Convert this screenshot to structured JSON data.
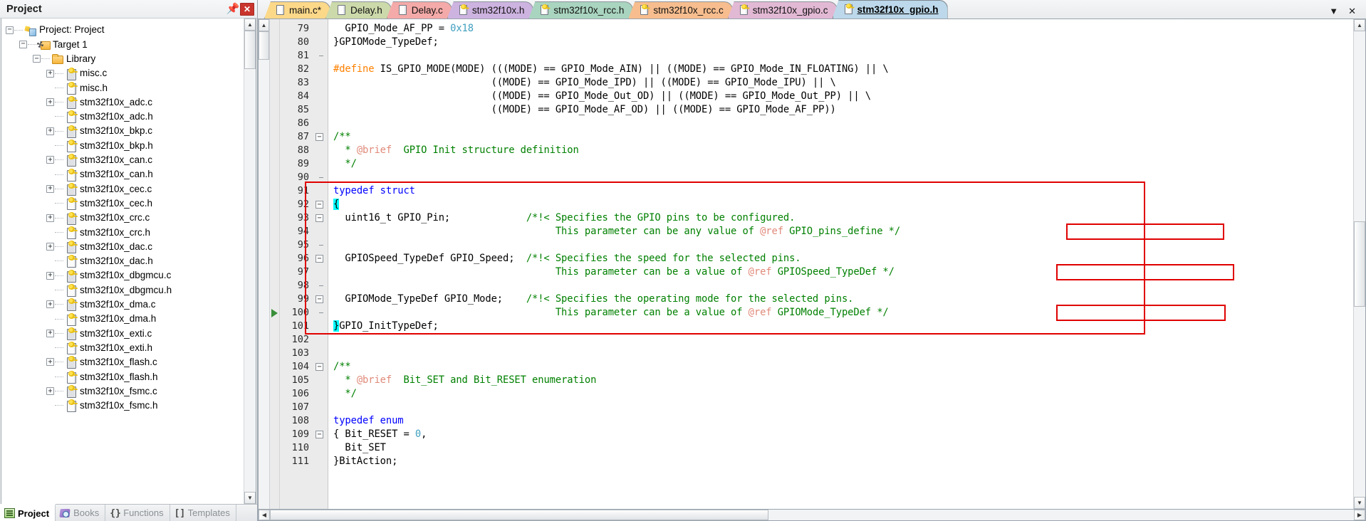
{
  "project_panel": {
    "title": "Project",
    "pin_icon": "pin-icon",
    "close_icon": "close-icon",
    "tree": [
      {
        "label": "Project: Project",
        "depth": 0,
        "twist": "minus",
        "icon": "project-icon"
      },
      {
        "label": "Target 1",
        "depth": 1,
        "twist": "minus",
        "icon": "target-icon"
      },
      {
        "label": "Library",
        "depth": 2,
        "twist": "minus",
        "icon": "folder-icon"
      },
      {
        "label": "misc.c",
        "depth": 3,
        "twist": "plus",
        "icon": "source-file-icon"
      },
      {
        "label": "misc.h",
        "depth": 3,
        "twist": "none",
        "icon": "header-file-icon"
      },
      {
        "label": "stm32f10x_adc.c",
        "depth": 3,
        "twist": "plus",
        "icon": "source-file-icon"
      },
      {
        "label": "stm32f10x_adc.h",
        "depth": 3,
        "twist": "none",
        "icon": "header-file-icon"
      },
      {
        "label": "stm32f10x_bkp.c",
        "depth": 3,
        "twist": "plus",
        "icon": "source-file-icon"
      },
      {
        "label": "stm32f10x_bkp.h",
        "depth": 3,
        "twist": "none",
        "icon": "header-file-icon"
      },
      {
        "label": "stm32f10x_can.c",
        "depth": 3,
        "twist": "plus",
        "icon": "source-file-icon"
      },
      {
        "label": "stm32f10x_can.h",
        "depth": 3,
        "twist": "none",
        "icon": "header-file-icon"
      },
      {
        "label": "stm32f10x_cec.c",
        "depth": 3,
        "twist": "plus",
        "icon": "source-file-icon"
      },
      {
        "label": "stm32f10x_cec.h",
        "depth": 3,
        "twist": "none",
        "icon": "header-file-icon"
      },
      {
        "label": "stm32f10x_crc.c",
        "depth": 3,
        "twist": "plus",
        "icon": "source-file-icon"
      },
      {
        "label": "stm32f10x_crc.h",
        "depth": 3,
        "twist": "none",
        "icon": "header-file-icon"
      },
      {
        "label": "stm32f10x_dac.c",
        "depth": 3,
        "twist": "plus",
        "icon": "source-file-icon"
      },
      {
        "label": "stm32f10x_dac.h",
        "depth": 3,
        "twist": "none",
        "icon": "header-file-icon"
      },
      {
        "label": "stm32f10x_dbgmcu.c",
        "depth": 3,
        "twist": "plus",
        "icon": "source-file-icon"
      },
      {
        "label": "stm32f10x_dbgmcu.h",
        "depth": 3,
        "twist": "none",
        "icon": "header-file-icon"
      },
      {
        "label": "stm32f10x_dma.c",
        "depth": 3,
        "twist": "plus",
        "icon": "source-file-icon"
      },
      {
        "label": "stm32f10x_dma.h",
        "depth": 3,
        "twist": "none",
        "icon": "header-file-icon"
      },
      {
        "label": "stm32f10x_exti.c",
        "depth": 3,
        "twist": "plus",
        "icon": "source-file-icon"
      },
      {
        "label": "stm32f10x_exti.h",
        "depth": 3,
        "twist": "none",
        "icon": "header-file-icon"
      },
      {
        "label": "stm32f10x_flash.c",
        "depth": 3,
        "twist": "plus",
        "icon": "source-file-icon"
      },
      {
        "label": "stm32f10x_flash.h",
        "depth": 3,
        "twist": "none",
        "icon": "header-file-icon"
      },
      {
        "label": "stm32f10x_fsmc.c",
        "depth": 3,
        "twist": "plus",
        "icon": "source-file-icon"
      },
      {
        "label": "stm32f10x_fsmc.h",
        "depth": 3,
        "twist": "none",
        "icon": "header-file-icon"
      }
    ],
    "bottom_tabs": [
      {
        "label": "Project",
        "active": true,
        "icon": "project-view-icon"
      },
      {
        "label": "Books",
        "active": false,
        "icon": "books-icon"
      },
      {
        "label": "Functions",
        "active": false,
        "icon": "braces-icon"
      },
      {
        "label": "Templates",
        "active": false,
        "icon": "templates-icon"
      }
    ]
  },
  "editor": {
    "tabs": [
      {
        "label": "main.c*",
        "color": "#fcd889",
        "icon": "source-file-icon",
        "key": false,
        "active": false
      },
      {
        "label": "Delay.h",
        "color": "#ccd9aa",
        "icon": "source-file-icon",
        "key": false,
        "active": false
      },
      {
        "label": "Delay.c",
        "color": "#f4aaa8",
        "icon": "source-file-icon",
        "key": false,
        "active": false
      },
      {
        "label": "stm32f10x.h",
        "color": "#cdb3e0",
        "icon": "header-file-icon",
        "key": true,
        "active": false
      },
      {
        "label": "stm32f10x_rcc.h",
        "color": "#a9d4bf",
        "icon": "header-file-icon",
        "key": true,
        "active": false
      },
      {
        "label": "stm32f10x_rcc.c",
        "color": "#f7bd8e",
        "icon": "source-file-icon",
        "key": true,
        "active": false
      },
      {
        "label": "stm32f10x_gpio.c",
        "color": "#e2b9d4",
        "icon": "source-file-icon",
        "key": true,
        "active": false
      },
      {
        "label": "stm32f10x_gpio.h",
        "color": "#bcd8ea",
        "icon": "header-file-icon",
        "key": true,
        "active": true
      }
    ],
    "controls": {
      "dropdown_icon": "chevron-down-icon",
      "close_icon": "close-icon"
    },
    "first_line_number": 79,
    "lines": [
      {
        "n": 79,
        "fold": "none",
        "tokens": [
          {
            "t": "  GPIO_Mode_AF_PP = ",
            "c": "plain"
          },
          {
            "t": "0x18",
            "c": "num"
          }
        ]
      },
      {
        "n": 80,
        "fold": "none",
        "tokens": [
          {
            "t": "}GPIOMode_TypeDef;",
            "c": "plain"
          }
        ]
      },
      {
        "n": 81,
        "fold": "tick",
        "tokens": [
          {
            "t": "",
            "c": "plain"
          }
        ]
      },
      {
        "n": 82,
        "fold": "none",
        "tokens": [
          {
            "t": "#define",
            "c": "pp"
          },
          {
            "t": " IS_GPIO_MODE(MODE) (((MODE) == GPIO_Mode_AIN) || ((MODE) == GPIO_Mode_IN_FLOATING) || \\",
            "c": "plain"
          }
        ]
      },
      {
        "n": 83,
        "fold": "none",
        "tokens": [
          {
            "t": "                           ((MODE) == GPIO_Mode_IPD) || ((MODE) == GPIO_Mode_IPU) || \\",
            "c": "plain"
          }
        ]
      },
      {
        "n": 84,
        "fold": "none",
        "tokens": [
          {
            "t": "                           ((MODE) == GPIO_Mode_Out_OD) || ((MODE) == GPIO_Mode_Out_PP) || \\",
            "c": "plain"
          }
        ]
      },
      {
        "n": 85,
        "fold": "none",
        "tokens": [
          {
            "t": "                           ((MODE) == GPIO_Mode_AF_OD) || ((MODE) == GPIO_Mode_AF_PP))",
            "c": "plain"
          }
        ]
      },
      {
        "n": 86,
        "fold": "none",
        "tokens": [
          {
            "t": "",
            "c": "plain"
          }
        ]
      },
      {
        "n": 87,
        "fold": "minus",
        "tokens": [
          {
            "t": "/**",
            "c": "cm"
          }
        ]
      },
      {
        "n": 88,
        "fold": "none",
        "tokens": [
          {
            "t": "  * ",
            "c": "cm"
          },
          {
            "t": "@brief",
            "c": "ref"
          },
          {
            "t": "  GPIO Init structure definition",
            "c": "cm"
          }
        ]
      },
      {
        "n": 89,
        "fold": "none",
        "tokens": [
          {
            "t": "  */",
            "c": "cm"
          }
        ]
      },
      {
        "n": 90,
        "fold": "tick",
        "tokens": [
          {
            "t": "",
            "c": "plain"
          }
        ]
      },
      {
        "n": 91,
        "fold": "none",
        "tokens": [
          {
            "t": "typedef struct",
            "c": "kw"
          }
        ]
      },
      {
        "n": 92,
        "fold": "minus",
        "tokens": [
          {
            "t": "{",
            "c": "brace-hl"
          }
        ]
      },
      {
        "n": 93,
        "fold": "minus",
        "tokens": [
          {
            "t": "  uint16_t GPIO_Pin;             ",
            "c": "plain"
          },
          {
            "t": "/*!< Specifies the GPIO pins to be configured.",
            "c": "cm"
          }
        ]
      },
      {
        "n": 94,
        "fold": "none",
        "tokens": [
          {
            "t": "                                      This parameter can be any value of ",
            "c": "cm"
          },
          {
            "t": "@ref",
            "c": "ref"
          },
          {
            "t": " GPIO_pins_define */",
            "c": "cm"
          }
        ]
      },
      {
        "n": 95,
        "fold": "tick",
        "tokens": [
          {
            "t": "",
            "c": "plain"
          }
        ]
      },
      {
        "n": 96,
        "fold": "minus",
        "tokens": [
          {
            "t": "  GPIOSpeed_TypeDef GPIO_Speed;  ",
            "c": "plain"
          },
          {
            "t": "/*!< Specifies the speed for the selected pins.",
            "c": "cm"
          }
        ]
      },
      {
        "n": 97,
        "fold": "none",
        "tokens": [
          {
            "t": "                                      This parameter can be a value of ",
            "c": "cm"
          },
          {
            "t": "@ref",
            "c": "ref"
          },
          {
            "t": " GPIOSpeed_TypeDef */",
            "c": "cm"
          }
        ]
      },
      {
        "n": 98,
        "fold": "tick",
        "tokens": [
          {
            "t": "",
            "c": "plain"
          }
        ]
      },
      {
        "n": 99,
        "fold": "minus",
        "tokens": [
          {
            "t": "  GPIOMode_TypeDef GPIO_Mode;    ",
            "c": "plain"
          },
          {
            "t": "/*!< Specifies the operating mode for the selected pins.",
            "c": "cm"
          }
        ]
      },
      {
        "n": 100,
        "fold": "tick",
        "tokens": [
          {
            "t": "                                      This parameter can be a value of ",
            "c": "cm"
          },
          {
            "t": "@ref",
            "c": "ref"
          },
          {
            "t": " GPIOMode_TypeDef */",
            "c": "cm"
          }
        ]
      },
      {
        "n": 101,
        "fold": "none",
        "tokens": [
          {
            "t": "}",
            "c": "brace-hl"
          },
          {
            "t": "GPIO_InitTypeDef;",
            "c": "plain"
          }
        ]
      },
      {
        "n": 102,
        "fold": "none",
        "tokens": [
          {
            "t": "",
            "c": "plain"
          }
        ]
      },
      {
        "n": 103,
        "fold": "none",
        "tokens": [
          {
            "t": "",
            "c": "plain"
          }
        ]
      },
      {
        "n": 104,
        "fold": "minus",
        "tokens": [
          {
            "t": "/**",
            "c": "cm"
          }
        ]
      },
      {
        "n": 105,
        "fold": "none",
        "tokens": [
          {
            "t": "  * ",
            "c": "cm"
          },
          {
            "t": "@brief",
            "c": "ref"
          },
          {
            "t": "  Bit_SET and Bit_RESET enumeration",
            "c": "cm"
          }
        ]
      },
      {
        "n": 106,
        "fold": "none",
        "tokens": [
          {
            "t": "  */",
            "c": "cm"
          }
        ]
      },
      {
        "n": 107,
        "fold": "none",
        "tokens": [
          {
            "t": "",
            "c": "plain"
          }
        ]
      },
      {
        "n": 108,
        "fold": "none",
        "tokens": [
          {
            "t": "typedef enum",
            "c": "kw"
          }
        ]
      },
      {
        "n": 109,
        "fold": "minus",
        "tokens": [
          {
            "t": "{ Bit_RESET = ",
            "c": "plain"
          },
          {
            "t": "0",
            "c": "num"
          },
          {
            "t": ",",
            "c": "plain"
          }
        ]
      },
      {
        "n": 110,
        "fold": "none",
        "tokens": [
          {
            "t": "  Bit_SET",
            "c": "plain"
          }
        ]
      },
      {
        "n": 111,
        "fold": "none",
        "tokens": [
          {
            "t": "}BitAction;",
            "c": "plain"
          }
        ]
      }
    ],
    "annotations": [
      {
        "name": "struct-outer-box"
      },
      {
        "name": "gpio-pins-define-ref-box"
      },
      {
        "name": "gpiospeed-typedef-ref-box"
      },
      {
        "name": "gpiomode-typedef-ref-box"
      }
    ],
    "exec_marker_line": 100
  }
}
